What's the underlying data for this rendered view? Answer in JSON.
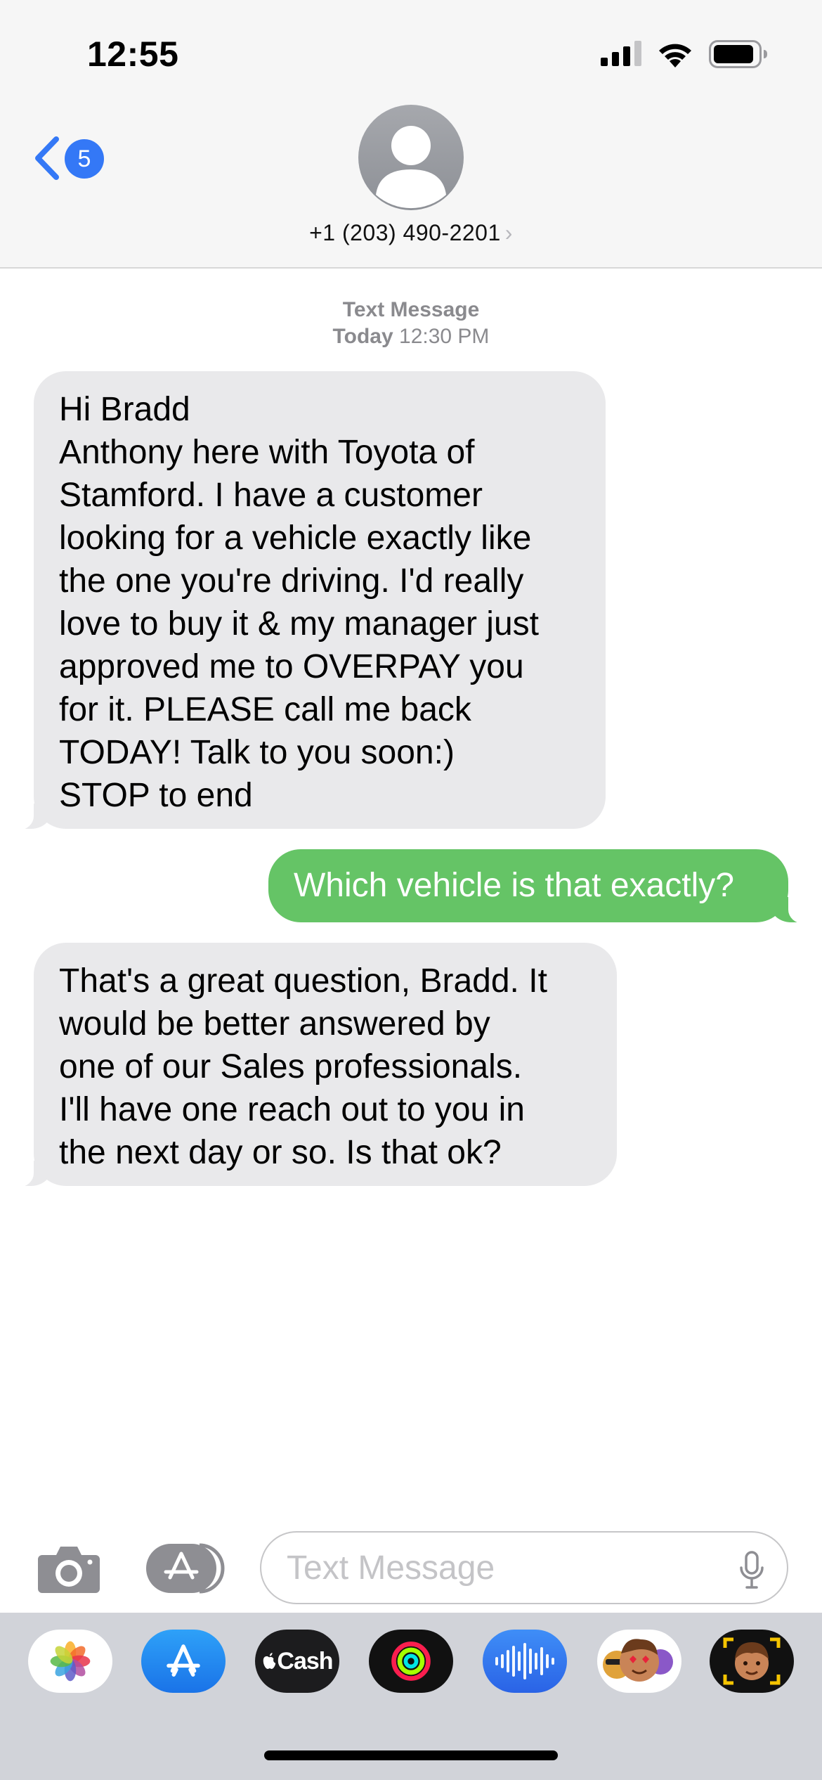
{
  "status_bar": {
    "time": "12:55",
    "icons": [
      "cellular-signal-icon",
      "wifi-icon",
      "battery-icon"
    ]
  },
  "header": {
    "back_badge_count": "5",
    "contact_name": "+1 (203) 490-2201",
    "contact_chevron": "›",
    "avatar_icon": "person-silhouette-icon"
  },
  "thread": {
    "service_label": "Text Message",
    "timestamp_day": "Today",
    "timestamp_time": "12:30 PM",
    "messages": [
      {
        "direction": "incoming",
        "lines": [
          "Hi Bradd",
          "Anthony here with Toyota of",
          "Stamford. I have a customer",
          "looking for a vehicle exactly like",
          "the one you're driving. I'd really",
          "love to buy it & my manager just",
          "approved me to OVERPAY you",
          "for it. PLEASE call me back",
          "TODAY! Talk to you soon:)",
          "STOP to end"
        ]
      },
      {
        "direction": "outgoing",
        "lines": [
          "Which vehicle is that exactly?"
        ]
      },
      {
        "direction": "incoming",
        "lines": [
          "That's a great question, Bradd. It",
          "would be better answered by",
          "one of our Sales professionals.",
          "I'll have one reach out to you in",
          "the next day or so. Is that ok?"
        ]
      }
    ]
  },
  "compose": {
    "placeholder": "Text Message",
    "value": "",
    "camera_icon": "camera-icon",
    "apps_icon": "app-store-icon",
    "mic_icon": "microphone-icon"
  },
  "app_tray": {
    "apps": [
      "photos-app-icon",
      "app-store-app-icon",
      "apple-cash-app-icon",
      "activity-app-icon",
      "audio-message-app-icon",
      "memoji-stickers-app-icon",
      "memoji-app-icon"
    ],
    "cash_label": "Cash"
  },
  "colors": {
    "accent_blue": "#3478f6",
    "outgoing_bubble": "#65c466",
    "incoming_bubble": "#e9e9eb",
    "header_background": "#f6f6f6",
    "tray_background": "#d1d3d9"
  }
}
